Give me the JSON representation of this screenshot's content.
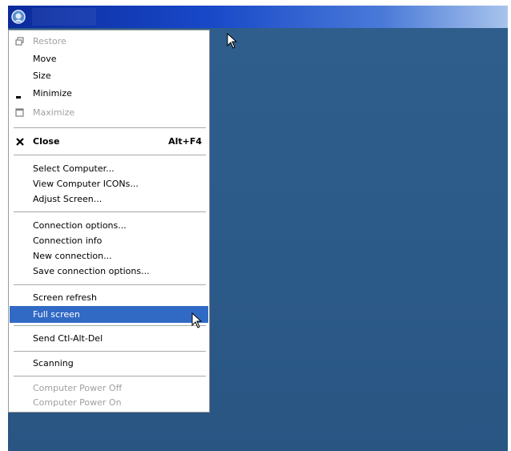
{
  "window": {
    "app_icon": "remote-console-icon"
  },
  "menu": {
    "restore_label": "Restore",
    "move_label": "Move",
    "size_label": "Size",
    "minimize_label": "Minimize",
    "maximize_label": "Maximize",
    "close_label": "Close",
    "close_accel": "Alt+F4",
    "select_computer_label": "Select Computer...",
    "view_icons_label": "View Computer ICONs...",
    "adjust_screen_label": "Adjust Screen...",
    "connection_options_label": "Connection options...",
    "connection_info_label": "Connection info",
    "new_connection_label": "New connection...",
    "save_connection_label": "Save connection options...",
    "screen_refresh_label": "Screen refresh",
    "full_screen_label": "Full screen",
    "send_cad_label": "Send Ctl-Alt-Del",
    "scanning_label": "Scanning",
    "power_off_label": "Computer Power Off",
    "power_on_label": "Computer Power On"
  },
  "colors": {
    "desktop": "#2f5d8a",
    "selection": "#316ac5",
    "titlebar": "#0b2a9c"
  }
}
